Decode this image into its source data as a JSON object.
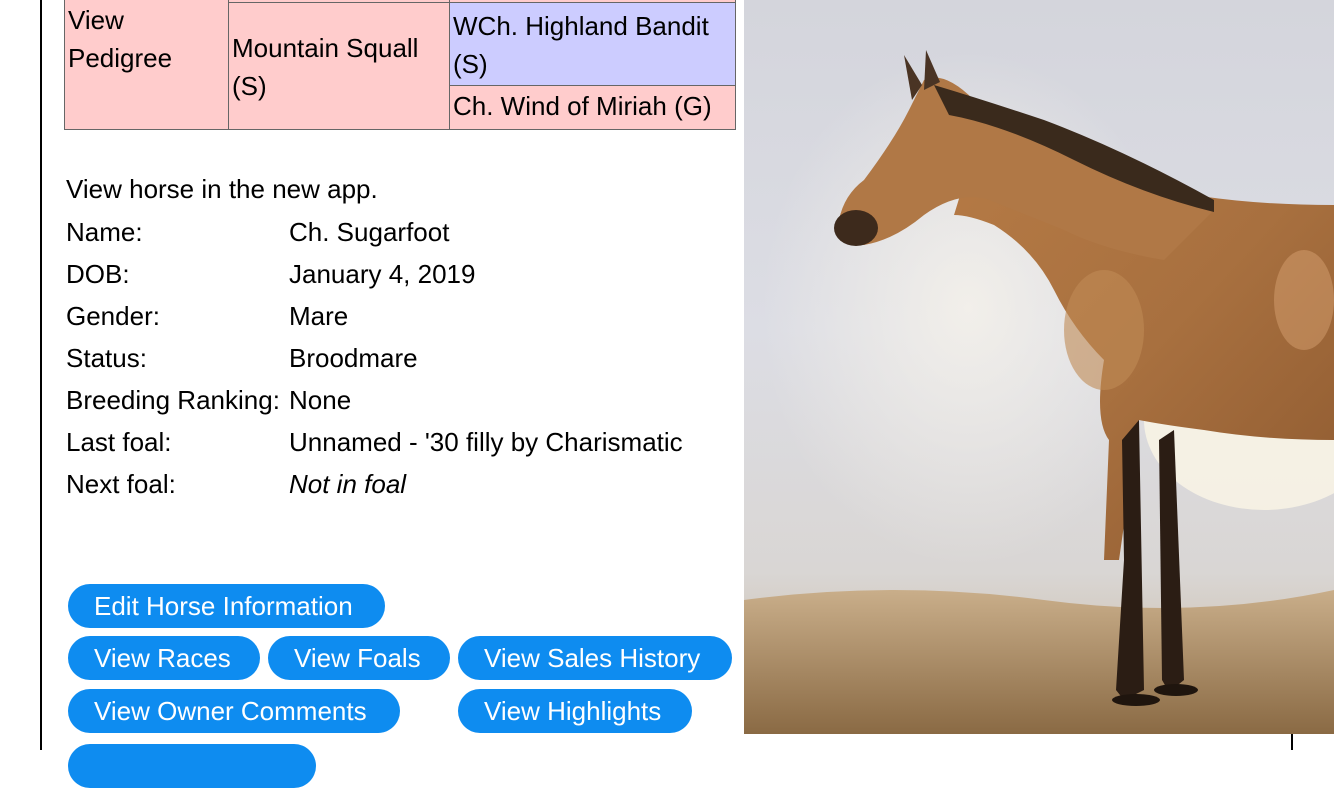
{
  "pedigree": {
    "view_link": "View Pedigree",
    "dam_sire": "Mountain Squall (S)",
    "grand_sire": "WCh. Highland Bandit (S)",
    "grand_dam": "Ch. Wind of Miriah (G)"
  },
  "app_link": "View horse in the new app.",
  "info": {
    "name_label": "Name:",
    "name": "Ch. Sugarfoot",
    "dob_label": "DOB:",
    "dob": "January 4, 2019",
    "gender_label": "Gender:",
    "gender": "Mare",
    "status_label": "Status:",
    "status": "Broodmare",
    "ranking_label": "Breeding Ranking:",
    "ranking": "None",
    "last_foal_label": "Last foal:",
    "last_foal": "Unnamed - '30 filly by Charismatic",
    "next_foal_label": "Next foal:",
    "next_foal": "Not in foal"
  },
  "buttons": {
    "edit": "Edit Horse Information",
    "races": "View Races",
    "foals": "View Foals",
    "sales": "View Sales History",
    "comments": "View Owner Comments",
    "highlights": "View Highlights"
  },
  "colors": {
    "accent": "#0e8cf0",
    "pink_cell": "#ffcccc",
    "blue_cell": "#ccccff"
  }
}
